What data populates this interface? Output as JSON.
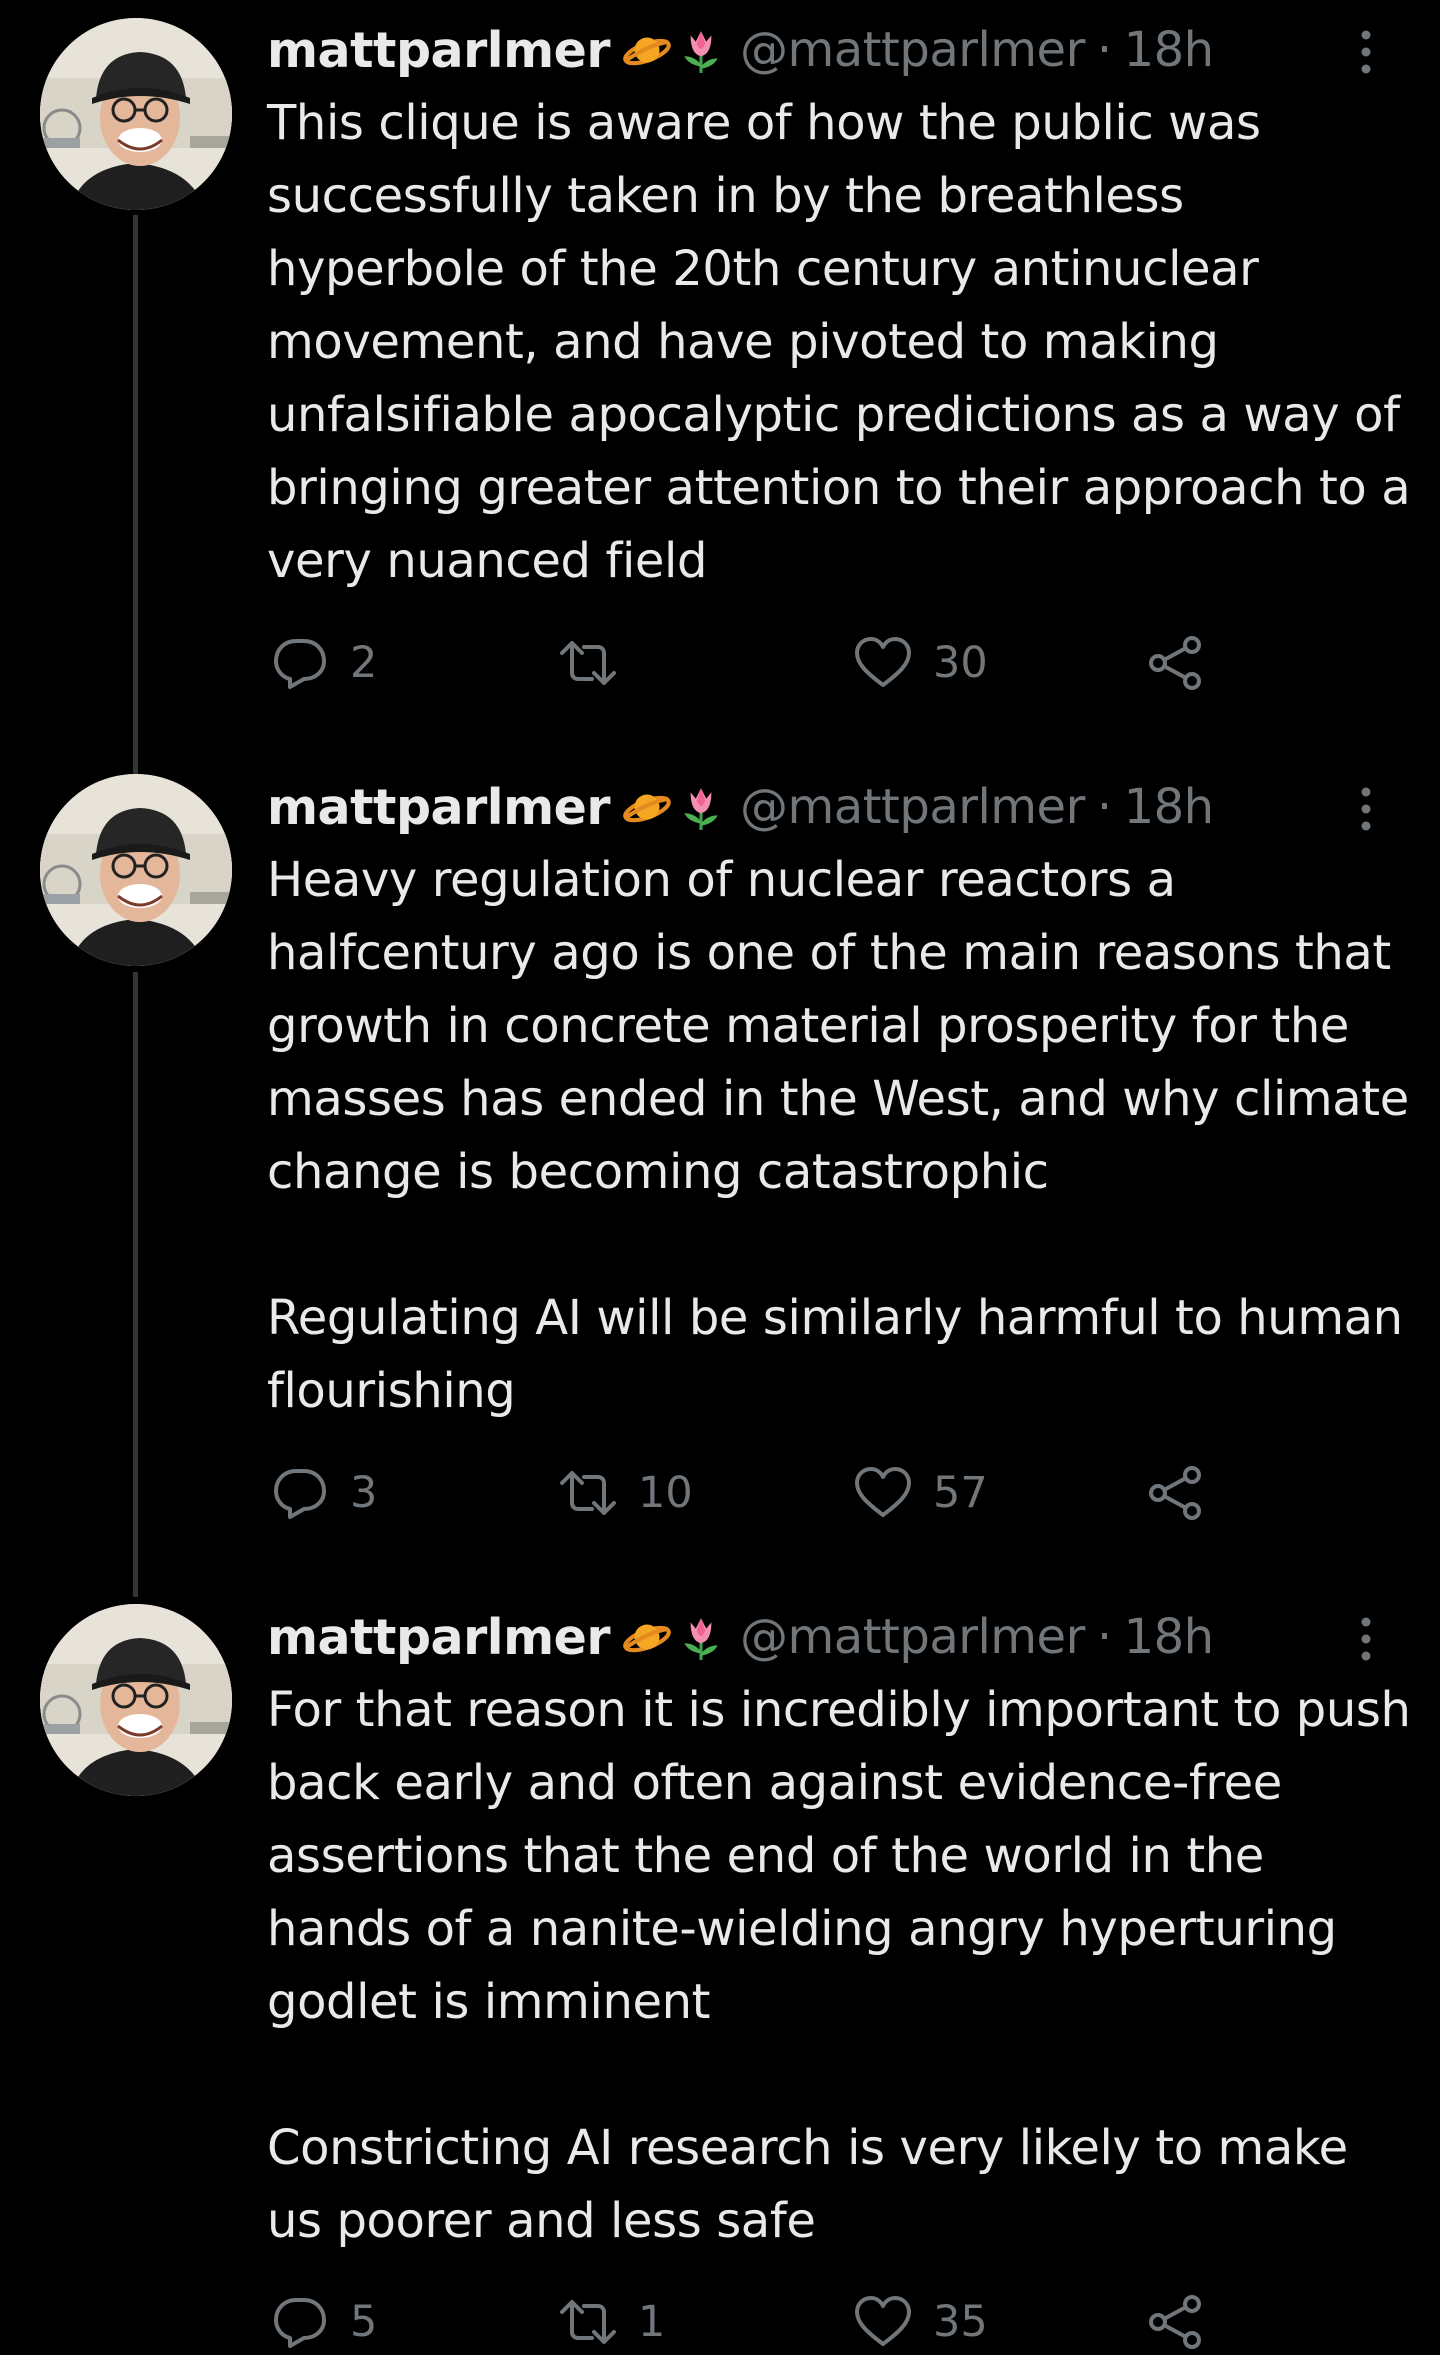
{
  "tweets": [
    {
      "display_name": "mattparlmer",
      "badge_icons": [
        "ringed-planet-icon",
        "tulip-icon"
      ],
      "handle": "@mattparlmer",
      "separator": "·",
      "time": "18h",
      "paragraphs": [
        "This clique is aware of how the public was successfully taken in by the breathless hyperbole of the 20th century antinuclear movement, and have pivoted to making unfalsifiable apocalyptic predictions as a way of bringing greater attention to their approach to a very nuanced field"
      ],
      "replies": "2",
      "retweets": "",
      "likes": "30"
    },
    {
      "display_name": "mattparlmer",
      "badge_icons": [
        "ringed-planet-icon",
        "tulip-icon"
      ],
      "handle": "@mattparlmer",
      "separator": "·",
      "time": "18h",
      "paragraphs": [
        "Heavy regulation of nuclear reactors a halfcentury ago is one of the main reasons that growth in concrete material prosperity for the masses has ended in the West, and why climate change is becoming catastrophic",
        "Regulating AI will be similarly harmful to human flourishing"
      ],
      "replies": "3",
      "retweets": "10",
      "likes": "57"
    },
    {
      "display_name": "mattparlmer",
      "badge_icons": [
        "ringed-planet-icon",
        "tulip-icon"
      ],
      "handle": "@mattparlmer",
      "separator": "·",
      "time": "18h",
      "paragraphs": [
        "For that reason it is incredibly important to push back early and often against evidence-free assertions that the end of the world in the hands of a nanite-wielding angry hyperturing godlet is imminent",
        "Constricting AI research is very likely to make us poorer and less safe"
      ],
      "replies": "5",
      "retweets": "1",
      "likes": "35"
    }
  ],
  "colors": {
    "background": "#000000",
    "text_primary": "#e7e9ea",
    "text_secondary": "#71767b",
    "thread_line": "#333639"
  }
}
